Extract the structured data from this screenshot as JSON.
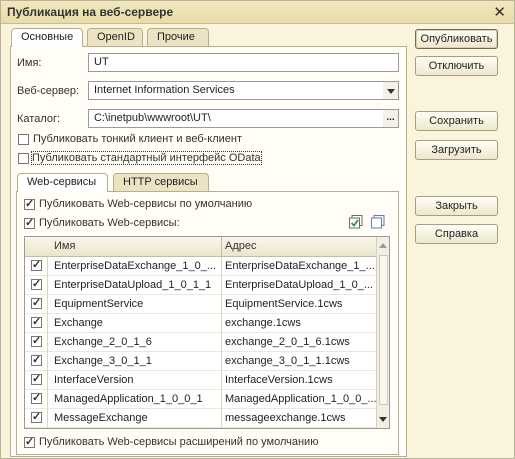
{
  "window": {
    "title": "Публикация на веб-сервере",
    "close_glyph": "✕"
  },
  "tabs": [
    "Основные",
    "OpenID",
    "Прочие"
  ],
  "form": {
    "name_label": "Имя:",
    "name_value": "UT",
    "webserver_label": "Веб-сервер:",
    "webserver_value": "Internet Information Services",
    "catalog_label": "Каталог:",
    "catalog_value": "C:\\inetpub\\wwwroot\\UT\\",
    "catalog_btn": "...",
    "cb_thin_client": {
      "label": "Публиковать тонкий клиент и веб-клиент",
      "checked": false
    },
    "cb_odata": {
      "label": "Публиковать стандартный интерфейс OData",
      "checked": false
    }
  },
  "subtabs": [
    "Web-сервисы",
    "HTTP сервисы"
  ],
  "ws": {
    "cb_default": {
      "label": "Публиковать Web-сервисы по умолчанию",
      "checked": true
    },
    "cb_publish": {
      "label": "Публиковать Web-сервисы:",
      "checked": true
    },
    "columns": [
      "Имя",
      "Адрес"
    ],
    "rows": [
      {
        "name": "EnterpriseDataExchange_1_0_...",
        "address": "EnterpriseDataExchange_1_...",
        "checked": true
      },
      {
        "name": "EnterpriseDataUpload_1_0_1_1",
        "address": "EnterpriseDataUpload_1_0_...",
        "checked": true
      },
      {
        "name": "EquipmentService",
        "address": "EquipmentService.1cws",
        "checked": true
      },
      {
        "name": "Exchange",
        "address": "exchange.1cws",
        "checked": true
      },
      {
        "name": "Exchange_2_0_1_6",
        "address": "exchange_2_0_1_6.1cws",
        "checked": true
      },
      {
        "name": "Exchange_3_0_1_1",
        "address": "exchange_3_0_1_1.1cws",
        "checked": true
      },
      {
        "name": "InterfaceVersion",
        "address": "InterfaceVersion.1cws",
        "checked": true
      },
      {
        "name": "ManagedApplication_1_0_0_1",
        "address": "ManagedApplication_1_0_0_...",
        "checked": true
      },
      {
        "name": "MessageExchange",
        "address": "messageexchange.1cws",
        "checked": true
      }
    ],
    "cb_ext": {
      "label": "Публиковать Web-сервисы расширений по умолчанию",
      "checked": true
    }
  },
  "buttons": {
    "publish": "Опубликовать",
    "disable": "Отключить",
    "save": "Сохранить",
    "load": "Загрузить",
    "close": "Закрыть",
    "help": "Справка"
  },
  "icons": {
    "check_all": "check-all-icon",
    "uncheck_all": "uncheck-all-icon",
    "accent": "#3a8f3a"
  }
}
